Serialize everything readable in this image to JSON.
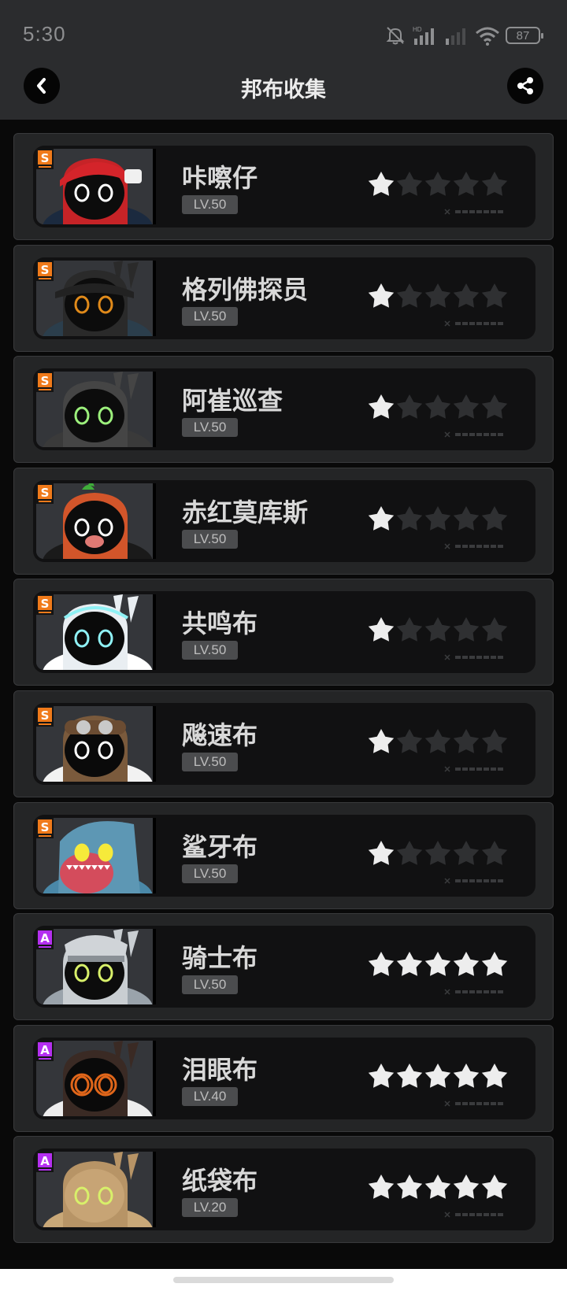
{
  "status_bar": {
    "time": "5:30",
    "battery": "87"
  },
  "header": {
    "title": "邦布收集"
  },
  "colors": {
    "star_on": "#ededed",
    "star_off": "#2f3032",
    "rank_s": "#f07a1a",
    "rank_a": "#b42ff0"
  },
  "bangboos": [
    {
      "name": "咔嚓仔",
      "level": "LV.50",
      "rank": "S",
      "stars": 1,
      "art": "cap-red",
      "body": "#1b2a3f",
      "hat": "#c62327",
      "eye": "#ffffff"
    },
    {
      "name": "格列佛探员",
      "level": "LV.50",
      "rank": "S",
      "stars": 1,
      "art": "detective",
      "body": "#2b3e4c",
      "hat": "#2a2a2a",
      "eye": "#e08a1a"
    },
    {
      "name": "阿崔巡查",
      "level": "LV.50",
      "rank": "S",
      "stars": 1,
      "art": "patrol",
      "body": "#3a3a3a",
      "hat": "#454545",
      "eye": "#9cf07c"
    },
    {
      "name": "赤红莫库斯",
      "level": "LV.50",
      "rank": "S",
      "stars": 1,
      "art": "boar",
      "body": "#1a1a1a",
      "hat": "#d2552a",
      "eye": "#ffffff"
    },
    {
      "name": "共鸣布",
      "level": "LV.50",
      "rank": "S",
      "stars": 1,
      "art": "resonance",
      "body": "#ffffff",
      "hat": "#e9eef2",
      "eye": "#8ff1f5"
    },
    {
      "name": "飚速布",
      "level": "LV.50",
      "rank": "S",
      "stars": 1,
      "art": "pilot",
      "body": "#f2f2f2",
      "hat": "#7a5a3c",
      "eye": "#ffffff"
    },
    {
      "name": "鲨牙布",
      "level": "LV.50",
      "rank": "S",
      "stars": 1,
      "art": "shark",
      "body": "#4a88a8",
      "hat": "#5d97b4",
      "eye": "#f6ea3a"
    },
    {
      "name": "骑士布",
      "level": "LV.50",
      "rank": "A",
      "stars": 5,
      "art": "knight",
      "body": "#9aa3ab",
      "hat": "#c9ced2",
      "eye": "#d8f06a"
    },
    {
      "name": "泪眼布",
      "level": "LV.40",
      "rank": "A",
      "stars": 5,
      "art": "tearful",
      "body": "#ededed",
      "hat": "#3a2a24",
      "eye": "#e0661a"
    },
    {
      "name": "纸袋布",
      "level": "LV.20",
      "rank": "A",
      "stars": 5,
      "art": "paperbag",
      "body": "#c9a878",
      "hat": "#b79466",
      "eye": "#d8f06a"
    }
  ]
}
